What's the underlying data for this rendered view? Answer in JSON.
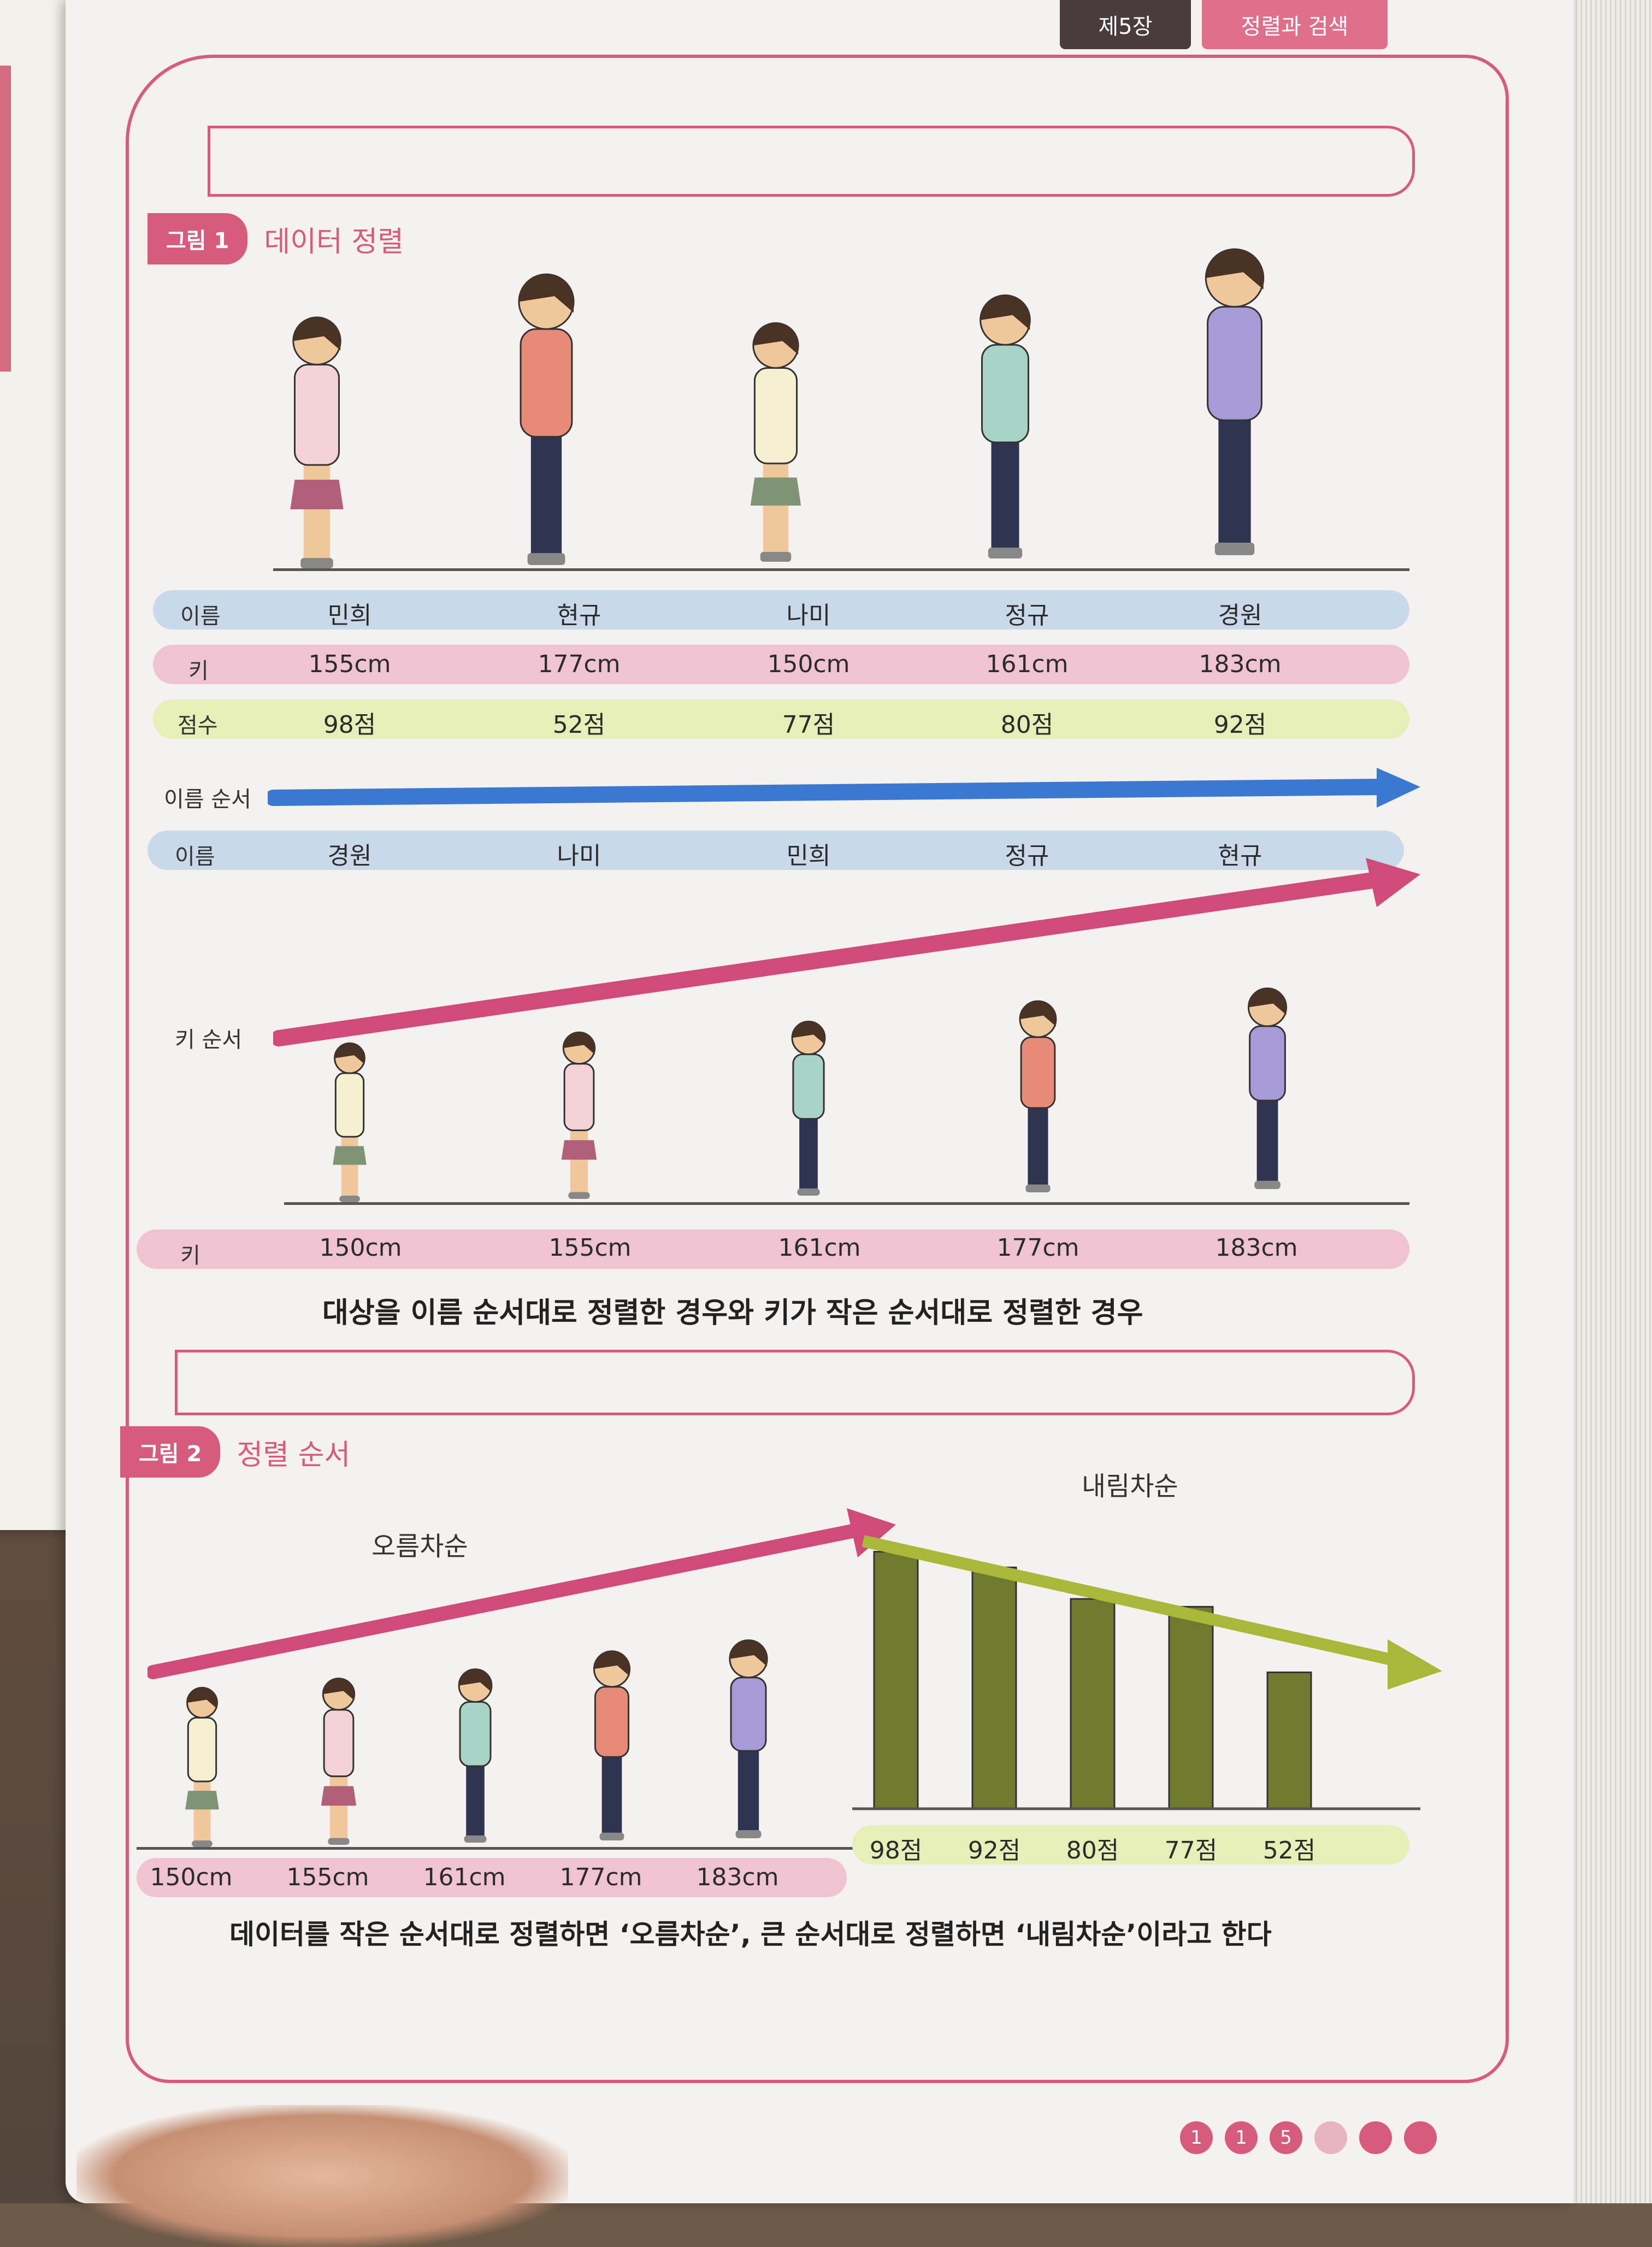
{
  "tabs": {
    "chapter": "제5장",
    "title": "정렬과 검색"
  },
  "figure1": {
    "badge": "그림 1",
    "title": "데이터 정렬",
    "row_labels": {
      "name": "이름",
      "height": "키",
      "score": "점수"
    },
    "people": [
      {
        "name": "민희",
        "height": "155cm",
        "score": "98점"
      },
      {
        "name": "현규",
        "height": "177cm",
        "score": "52점"
      },
      {
        "name": "나미",
        "height": "150cm",
        "score": "77점"
      },
      {
        "name": "정규",
        "height": "161cm",
        "score": "80점"
      },
      {
        "name": "경원",
        "height": "183cm",
        "score": "92점"
      }
    ],
    "name_order_label": "이름 순서",
    "name_sorted": [
      "경원",
      "나미",
      "민희",
      "정규",
      "현규"
    ],
    "height_order_label": "키 순서",
    "height_sorted": [
      "150cm",
      "155cm",
      "161cm",
      "177cm",
      "183cm"
    ],
    "caption": "대상을 이름 순서대로 정렬한 경우와 키가 작은 순서대로 정렬한 경우"
  },
  "figure2": {
    "badge": "그림 2",
    "title": "정렬 순서",
    "ascending_label": "오름차순",
    "descending_label": "내림차순",
    "ascending_values": [
      "150cm",
      "155cm",
      "161cm",
      "177cm",
      "183cm"
    ],
    "descending_values": [
      "98점",
      "92점",
      "80점",
      "77점",
      "52점"
    ],
    "caption": "데이터를 작은 순서대로 정렬하면 ‘오름차순’, 큰 순서대로 정렬하면 ‘내림차순’이라고 한다"
  },
  "page_number": [
    "1",
    "1",
    "5"
  ],
  "colors": {
    "accent": "#d65b7c",
    "name_row": "#c9d9ea",
    "height_row": "#efc3d2",
    "score_row": "#e6efb8",
    "arrow_blue": "#3a78d2",
    "arrow_pink": "#d04a7a",
    "arrow_green": "#aab83a",
    "bar": "#6f7a2e"
  },
  "chart_data": {
    "type": "bar",
    "categories": [
      "98점",
      "92점",
      "80점",
      "77점",
      "52점"
    ],
    "values": [
      98,
      92,
      80,
      77,
      52
    ],
    "title": "내림차순",
    "ylim": [
      0,
      100
    ]
  }
}
